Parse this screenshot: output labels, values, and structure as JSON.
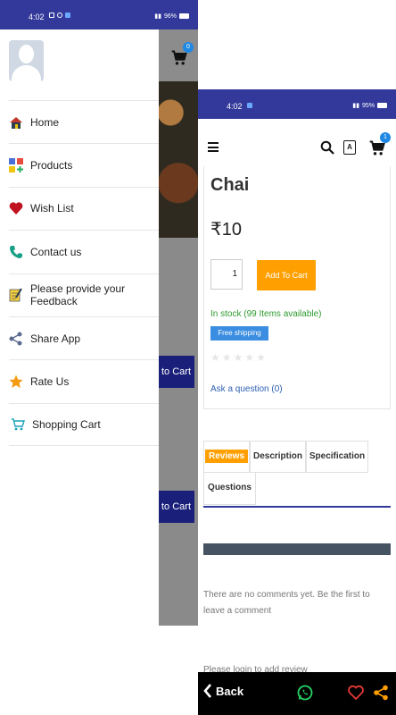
{
  "left_screen": {
    "status_bar": {
      "time": "4:02",
      "battery": "96%"
    },
    "menu": [
      {
        "label": "Home",
        "icon": "home-icon"
      },
      {
        "label": "Products",
        "icon": "products-grid-icon"
      },
      {
        "label": "Wish List",
        "icon": "heart-icon"
      },
      {
        "label": "Contact us",
        "icon": "phone-icon"
      },
      {
        "label": "Please provide your Feedback",
        "icon": "feedback-note-icon"
      },
      {
        "label": "Share App",
        "icon": "share-icon"
      },
      {
        "label": "Rate Us",
        "icon": "star-icon"
      },
      {
        "label": "Shopping Cart",
        "icon": "cart-icon"
      }
    ],
    "background_page": {
      "cart_badge": "0",
      "add_to_cart_fragment_1": "to Cart",
      "add_to_cart_fragment_2": "to Cart"
    }
  },
  "right_screen": {
    "status_bar": {
      "time": "4:02",
      "battery": "95%"
    },
    "app_bar": {
      "lang_icon": "A",
      "cart_badge": "1"
    },
    "product": {
      "title": "Chai",
      "price": "₹10",
      "quantity": "1",
      "add_to_cart_label": "Add To Cart",
      "stock_text": "In stock (99 Items available)",
      "shipping_badge": "Free shipping",
      "rating_stars": 0,
      "ask_question": "Ask a question (0)"
    },
    "tabs": [
      {
        "label": "Reviews",
        "active": true
      },
      {
        "label": "Description",
        "active": false
      },
      {
        "label": "Specification",
        "active": false
      },
      {
        "label": "Questions",
        "active": false
      }
    ],
    "reviews": {
      "empty_text": "There are no comments yet. Be the first to leave a comment",
      "login_text": "Please login to add review"
    },
    "bottom_bar": {
      "back_label": "Back"
    }
  },
  "colors": {
    "status_bar": "#32399a",
    "accent_orange": "#ff9f00",
    "badge_blue": "#1e88e5",
    "stock_green": "#2e9a2e",
    "link_blue": "#2d5fb3"
  }
}
